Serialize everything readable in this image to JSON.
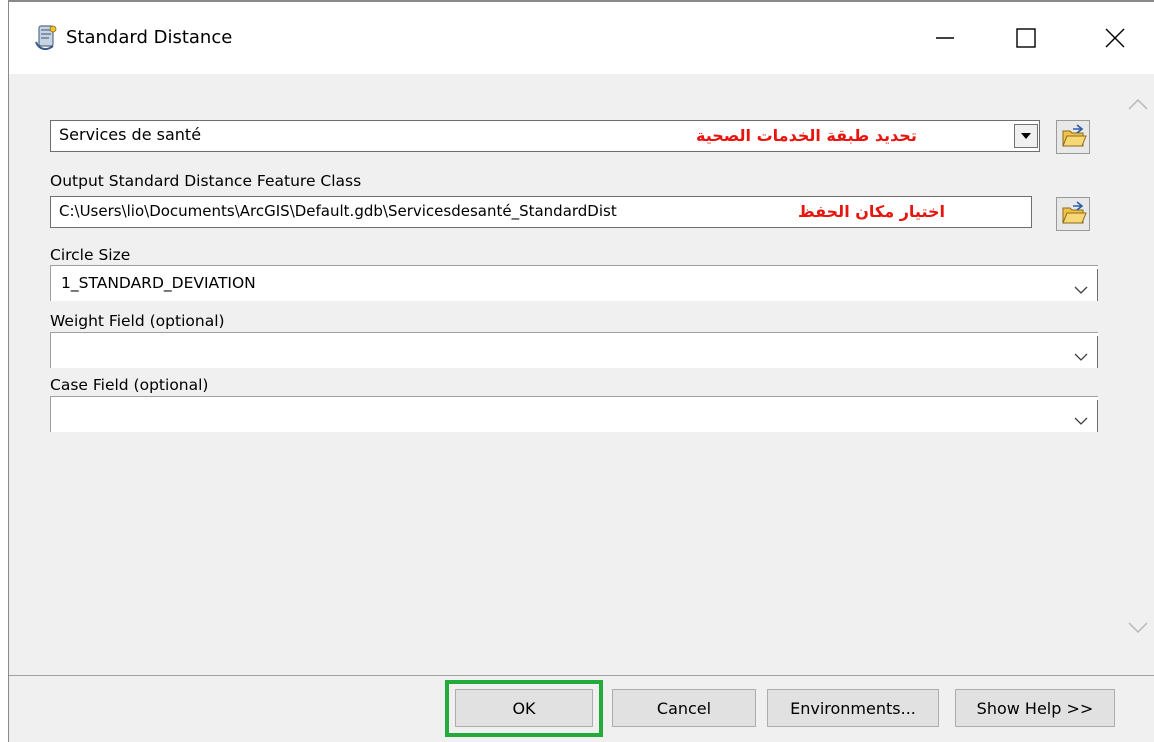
{
  "window": {
    "title": "Standard Distance"
  },
  "form": {
    "input_features": {
      "value": "Services de santé",
      "annotation": "تحديد طبقة الخدمات الصحية"
    },
    "output_feature_class": {
      "label": "Output Standard Distance Feature Class",
      "value": "C:\\Users\\lio\\Documents\\ArcGIS\\Default.gdb\\Servicesdesanté_StandardDist",
      "annotation": "اختيار مكان الحفظ"
    },
    "circle_size": {
      "label": "Circle Size",
      "value": "1_STANDARD_DEVIATION"
    },
    "weight_field": {
      "label": "Weight Field (optional)",
      "value": ""
    },
    "case_field": {
      "label": "Case Field (optional)",
      "value": ""
    }
  },
  "buttons": {
    "ok": "OK",
    "cancel": "Cancel",
    "environments": "Environments...",
    "show_help": "Show Help >>"
  },
  "colors": {
    "annotation": "#e8150f",
    "highlight": "#22aa3c",
    "dialog_background": "#f0f0f0"
  },
  "icons": {
    "app": "geoprocessing-tool-icon",
    "browse": "open-folder-icon",
    "dropdown": "chevron-down-icon",
    "scroll_up": "chevron-up-icon",
    "scroll_down": "chevron-down-icon"
  }
}
